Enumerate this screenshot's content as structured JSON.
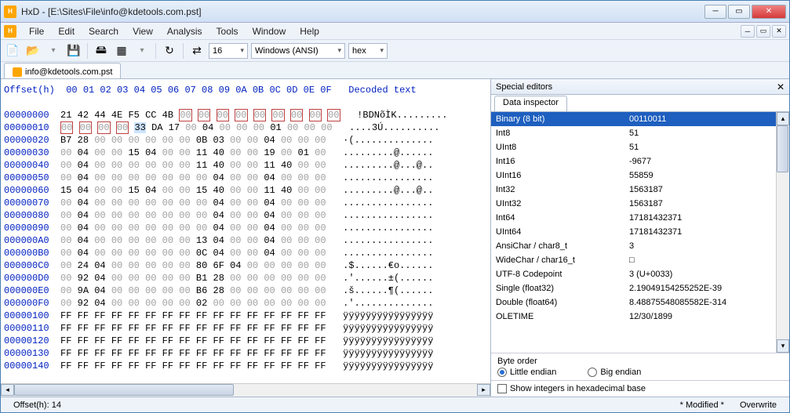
{
  "window": {
    "title": "HxD - [E:\\Sites\\File\\info@kdetools.com.pst]"
  },
  "menu": {
    "file": "File",
    "edit": "Edit",
    "search": "Search",
    "view": "View",
    "analysis": "Analysis",
    "tools": "Tools",
    "window": "Window",
    "help": "Help"
  },
  "toolbar": {
    "columns_value": "16",
    "encoding": "Windows (ANSI)",
    "base": "hex"
  },
  "tab": {
    "label": "info@kdetools.com.pst"
  },
  "hex": {
    "header_offset": "Offset(h)",
    "header_cols": "00 01 02 03 04 05 06 07 08 09 0A 0B 0C 0D 0E 0F",
    "header_decoded": "Decoded text",
    "rows": [
      {
        "off": "00000000",
        "b": [
          "21",
          "42",
          "44",
          "4E",
          "F5",
          "CC",
          "4B",
          "00",
          "00",
          "00",
          "00",
          "00",
          "00",
          "00",
          "00",
          "00"
        ],
        "t": "!BDNõÌK.........",
        "m": "r1"
      },
      {
        "off": "00000010",
        "b": [
          "00",
          "00",
          "00",
          "00",
          "33",
          "DA",
          "17",
          "00",
          "04",
          "00",
          "00",
          "00",
          "01",
          "00",
          "00",
          "00"
        ],
        "t": "....3Ú..........",
        "m": "r2"
      },
      {
        "off": "00000020",
        "b": [
          "B7",
          "28",
          "00",
          "00",
          "00",
          "00",
          "00",
          "00",
          "0B",
          "03",
          "00",
          "00",
          "04",
          "00",
          "00",
          "00"
        ],
        "t": "·(.............."
      },
      {
        "off": "00000030",
        "b": [
          "00",
          "04",
          "00",
          "00",
          "15",
          "04",
          "00",
          "00",
          "11",
          "40",
          "00",
          "00",
          "19",
          "00",
          "01",
          "00"
        ],
        "t": ".........@......"
      },
      {
        "off": "00000040",
        "b": [
          "00",
          "04",
          "00",
          "00",
          "00",
          "00",
          "00",
          "00",
          "11",
          "40",
          "00",
          "00",
          "11",
          "40",
          "00",
          "00"
        ],
        "t": ".........@...@.."
      },
      {
        "off": "00000050",
        "b": [
          "00",
          "04",
          "00",
          "00",
          "00",
          "00",
          "00",
          "00",
          "00",
          "04",
          "00",
          "00",
          "04",
          "00",
          "00",
          "00"
        ],
        "t": "................"
      },
      {
        "off": "00000060",
        "b": [
          "15",
          "04",
          "00",
          "00",
          "15",
          "04",
          "00",
          "00",
          "15",
          "40",
          "00",
          "00",
          "11",
          "40",
          "00",
          "00"
        ],
        "t": ".........@...@.."
      },
      {
        "off": "00000070",
        "b": [
          "00",
          "04",
          "00",
          "00",
          "00",
          "00",
          "00",
          "00",
          "00",
          "04",
          "00",
          "00",
          "04",
          "00",
          "00",
          "00"
        ],
        "t": "................"
      },
      {
        "off": "00000080",
        "b": [
          "00",
          "04",
          "00",
          "00",
          "00",
          "00",
          "00",
          "00",
          "00",
          "04",
          "00",
          "00",
          "04",
          "00",
          "00",
          "00"
        ],
        "t": "................"
      },
      {
        "off": "00000090",
        "b": [
          "00",
          "04",
          "00",
          "00",
          "00",
          "00",
          "00",
          "00",
          "00",
          "04",
          "00",
          "00",
          "04",
          "00",
          "00",
          "00"
        ],
        "t": "................"
      },
      {
        "off": "000000A0",
        "b": [
          "00",
          "04",
          "00",
          "00",
          "00",
          "00",
          "00",
          "00",
          "13",
          "04",
          "00",
          "00",
          "04",
          "00",
          "00",
          "00"
        ],
        "t": "................"
      },
      {
        "off": "000000B0",
        "b": [
          "00",
          "04",
          "00",
          "00",
          "00",
          "00",
          "00",
          "00",
          "0C",
          "04",
          "00",
          "00",
          "04",
          "00",
          "00",
          "00"
        ],
        "t": "................"
      },
      {
        "off": "000000C0",
        "b": [
          "00",
          "24",
          "04",
          "00",
          "00",
          "00",
          "00",
          "00",
          "80",
          "6F",
          "04",
          "00",
          "00",
          "00",
          "00",
          "00"
        ],
        "t": ".$......€o......"
      },
      {
        "off": "000000D0",
        "b": [
          "00",
          "92",
          "04",
          "00",
          "00",
          "00",
          "00",
          "00",
          "B1",
          "28",
          "00",
          "00",
          "00",
          "00",
          "00",
          "00"
        ],
        "t": ".'......±(......"
      },
      {
        "off": "000000E0",
        "b": [
          "00",
          "9A",
          "04",
          "00",
          "00",
          "00",
          "00",
          "00",
          "B6",
          "28",
          "00",
          "00",
          "00",
          "00",
          "00",
          "00"
        ],
        "t": ".š......¶(......"
      },
      {
        "off": "000000F0",
        "b": [
          "00",
          "92",
          "04",
          "00",
          "00",
          "00",
          "00",
          "00",
          "02",
          "00",
          "00",
          "00",
          "00",
          "00",
          "00",
          "00"
        ],
        "t": ".'.............."
      },
      {
        "off": "00000100",
        "b": [
          "FF",
          "FF",
          "FF",
          "FF",
          "FF",
          "FF",
          "FF",
          "FF",
          "FF",
          "FF",
          "FF",
          "FF",
          "FF",
          "FF",
          "FF",
          "FF"
        ],
        "t": "ÿÿÿÿÿÿÿÿÿÿÿÿÿÿÿÿ"
      },
      {
        "off": "00000110",
        "b": [
          "FF",
          "FF",
          "FF",
          "FF",
          "FF",
          "FF",
          "FF",
          "FF",
          "FF",
          "FF",
          "FF",
          "FF",
          "FF",
          "FF",
          "FF",
          "FF"
        ],
        "t": "ÿÿÿÿÿÿÿÿÿÿÿÿÿÿÿÿ"
      },
      {
        "off": "00000120",
        "b": [
          "FF",
          "FF",
          "FF",
          "FF",
          "FF",
          "FF",
          "FF",
          "FF",
          "FF",
          "FF",
          "FF",
          "FF",
          "FF",
          "FF",
          "FF",
          "FF"
        ],
        "t": "ÿÿÿÿÿÿÿÿÿÿÿÿÿÿÿÿ"
      },
      {
        "off": "00000130",
        "b": [
          "FF",
          "FF",
          "FF",
          "FF",
          "FF",
          "FF",
          "FF",
          "FF",
          "FF",
          "FF",
          "FF",
          "FF",
          "FF",
          "FF",
          "FF",
          "FF"
        ],
        "t": "ÿÿÿÿÿÿÿÿÿÿÿÿÿÿÿÿ"
      },
      {
        "off": "00000140",
        "b": [
          "FF",
          "FF",
          "FF",
          "FF",
          "FF",
          "FF",
          "FF",
          "FF",
          "FF",
          "FF",
          "FF",
          "FF",
          "FF",
          "FF",
          "FF",
          "FF"
        ],
        "t": "ÿÿÿÿÿÿÿÿÿÿÿÿÿÿÿÿ"
      }
    ]
  },
  "side": {
    "title": "Special editors",
    "tab": "Data inspector",
    "rows": [
      {
        "k": "Binary (8 bit)",
        "v": "00110011",
        "sel": true
      },
      {
        "k": "Int8",
        "v": "51"
      },
      {
        "k": "UInt8",
        "v": "51"
      },
      {
        "k": "Int16",
        "v": "-9677"
      },
      {
        "k": "UInt16",
        "v": "55859"
      },
      {
        "k": "Int32",
        "v": "1563187"
      },
      {
        "k": "UInt32",
        "v": "1563187"
      },
      {
        "k": "Int64",
        "v": "17181432371"
      },
      {
        "k": "UInt64",
        "v": "17181432371"
      },
      {
        "k": "AnsiChar / char8_t",
        "v": "3"
      },
      {
        "k": "WideChar / char16_t",
        "v": "□"
      },
      {
        "k": "UTF-8 Codepoint",
        "v": "3 (U+0033)"
      },
      {
        "k": "Single (float32)",
        "v": "2.19049154255252E-39"
      },
      {
        "k": "Double (float64)",
        "v": "8.48875548085582E-314"
      },
      {
        "k": "OLETIME",
        "v": "12/30/1899"
      }
    ],
    "byteorder_label": "Byte order",
    "little": "Little endian",
    "big": "Big endian",
    "showhex": "Show integers in hexadecimal base"
  },
  "status": {
    "offset": "Offset(h): 14",
    "modified": "* Modified *",
    "mode": "Overwrite"
  }
}
